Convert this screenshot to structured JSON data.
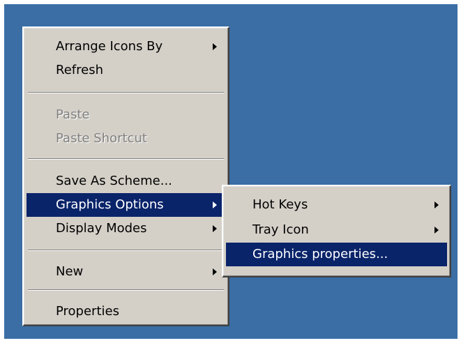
{
  "context_menu": {
    "items": [
      {
        "label": "Arrange Icons By",
        "has_submenu": true,
        "disabled": false
      },
      {
        "label": "Refresh",
        "has_submenu": false,
        "disabled": false
      },
      {
        "label": "Paste",
        "has_submenu": false,
        "disabled": true
      },
      {
        "label": "Paste Shortcut",
        "has_submenu": false,
        "disabled": true
      },
      {
        "label": "Save As Scheme...",
        "has_submenu": false,
        "disabled": false
      },
      {
        "label": "Graphics Options",
        "has_submenu": true,
        "disabled": false,
        "highlighted": true
      },
      {
        "label": "Display Modes",
        "has_submenu": true,
        "disabled": false
      },
      {
        "label": "New",
        "has_submenu": true,
        "disabled": false
      },
      {
        "label": "Properties",
        "has_submenu": false,
        "disabled": false
      }
    ]
  },
  "submenu": {
    "items": [
      {
        "label": "Hot Keys",
        "has_submenu": true
      },
      {
        "label": "Tray Icon",
        "has_submenu": true
      },
      {
        "label": "Graphics properties...",
        "has_submenu": false,
        "highlighted": true
      }
    ]
  },
  "colors": {
    "desktop": "#3a6ea5",
    "menu_face": "#d4d0c8",
    "highlight": "#0a246a",
    "disabled_text": "#808080"
  }
}
